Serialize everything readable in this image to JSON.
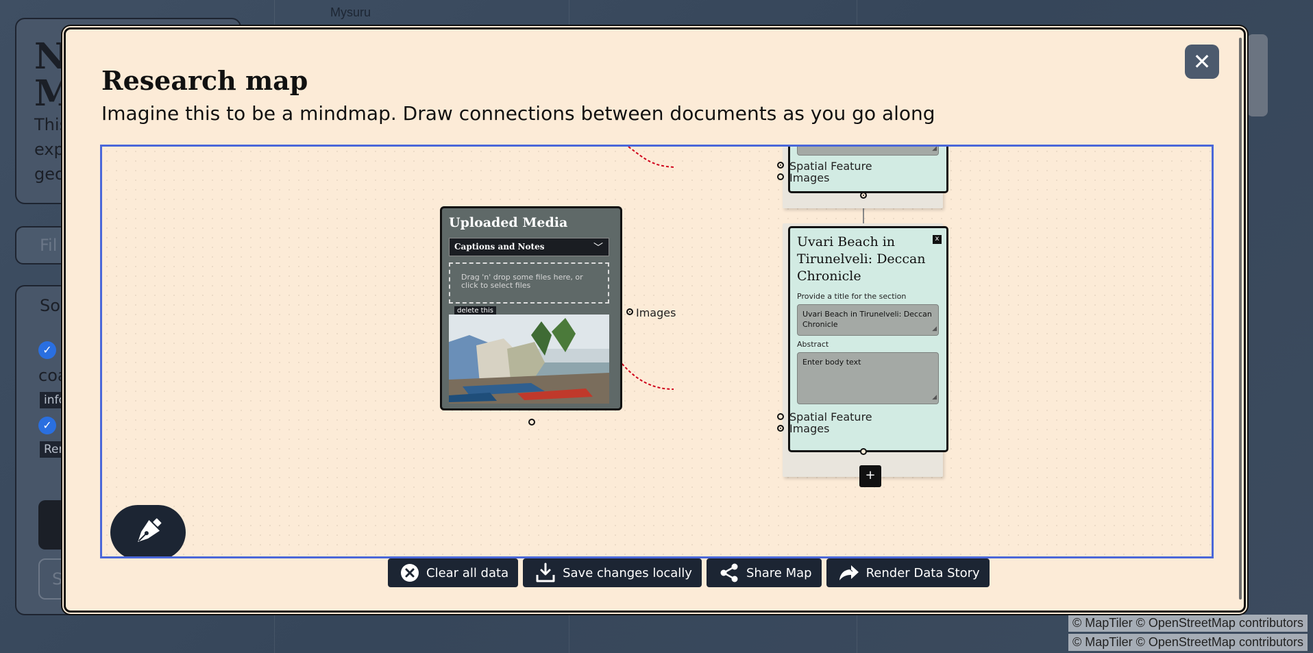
{
  "background": {
    "map_label": "Mysuru",
    "attribution": "© MapTiler © OpenStreetMap contributors",
    "panel_title": "Na\nM",
    "panel_text_lines": [
      "This",
      "exp",
      "geo"
    ],
    "filter_placeholder": "Fil",
    "sources_label": "Sou",
    "source_text": "coa",
    "tag_1": "info",
    "tag_2": "Ren",
    "outline_btn_label": "S"
  },
  "modal": {
    "title": "Research map",
    "subtitle": "Imagine this to be a mindmap. Draw connections between documents as you go along",
    "close_label": "✕"
  },
  "media_node": {
    "title": "Uploaded Media",
    "select_value": "Captions and Notes",
    "dropzone_text": "Drag 'n' drop some files here, or click to select files",
    "delete_label": "delete this",
    "output_port_label": "Images"
  },
  "top_doc_node": {
    "port_label_1": "Spatial Feature",
    "port_label_2": "Images"
  },
  "doc_node": {
    "title": "Uvari Beach in Tirunelveli: Deccan Chronicle",
    "close_label": "x",
    "title_field_label": "Provide a title for the section",
    "title_field_value": "Uvari Beach in Tirunelveli: Deccan Chronicle",
    "abstract_label": "Abstract",
    "abstract_placeholder": "Enter body text",
    "port_label_1": "Spatial Feature",
    "port_label_2": "Images"
  },
  "add_node_label": "+",
  "toolbar": {
    "clear_label": "Clear all data",
    "save_label": "Save changes locally",
    "share_label": "Share Map",
    "render_label": "Render Data Story"
  },
  "colors": {
    "modal_bg": "#fcebd7",
    "canvas_border": "#4a67d9",
    "dark_button": "#1c2533",
    "doc_node_bg": "#d2ebe3",
    "media_node_bg": "#5f6968",
    "edge_color": "#d0021b"
  },
  "icons": [
    "close-icon",
    "pen-icon",
    "x-circle-icon",
    "download-icon",
    "share-icon",
    "forward-icon",
    "chevron-down-icon",
    "resize-grip-icon"
  ]
}
